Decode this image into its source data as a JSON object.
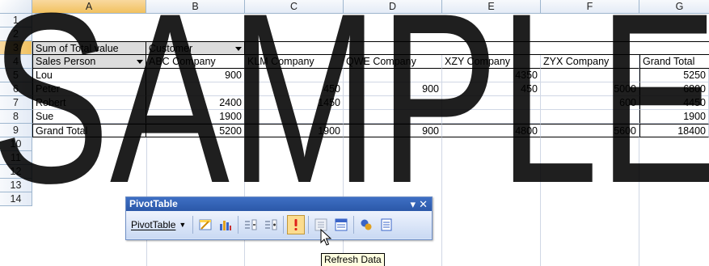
{
  "columns": [
    "A",
    "B",
    "C",
    "D",
    "E",
    "F",
    "G"
  ],
  "selected_column": "A",
  "row_numbers": [
    "1",
    "2",
    "3",
    "4",
    "5",
    "6",
    "7",
    "8",
    "9",
    "10",
    "11",
    "12",
    "13",
    "14"
  ],
  "selected_row": "3",
  "pivot": {
    "data_field": "Sum of Total value",
    "column_field": "Customer",
    "row_field": "Sales Person",
    "column_headers": [
      "ABC Company",
      "KLM Company",
      "QWE Company",
      "XZY Company",
      "ZYX Company",
      "Grand Total"
    ],
    "rows": [
      {
        "label": "Lou",
        "values": [
          "900",
          "",
          "",
          "4350",
          "",
          "5250"
        ]
      },
      {
        "label": "Peter",
        "values": [
          "",
          "450",
          "900",
          "450",
          "5000",
          "6800"
        ]
      },
      {
        "label": "Robert",
        "values": [
          "2400",
          "1450",
          "",
          "",
          "600",
          "4450"
        ]
      },
      {
        "label": "Sue",
        "values": [
          "1900",
          "",
          "",
          "",
          "",
          "1900"
        ]
      }
    ],
    "grand_total": {
      "label": "Grand Total",
      "values": [
        "5200",
        "1900",
        "900",
        "4800",
        "5600",
        "18400"
      ]
    }
  },
  "toolbar": {
    "title": "PivotTable",
    "menu_label": "PivotTable",
    "menu_chevron_icon": "dropdown-triangle",
    "title_dropdown_icon": "chevron-down",
    "title_close_icon": "close-x",
    "tools": [
      {
        "name": "format-report-icon"
      },
      {
        "name": "chart-wizard-icon"
      },
      {
        "name": "hide-detail-icon"
      },
      {
        "name": "show-detail-icon"
      },
      {
        "name": "refresh-data-icon"
      },
      {
        "name": "include-hidden-items-icon"
      },
      {
        "name": "always-display-items-icon"
      },
      {
        "name": "field-settings-icon"
      },
      {
        "name": "show-field-list-icon"
      }
    ],
    "pressed_tool": "refresh-data-icon"
  },
  "tooltip": "Refresh Data",
  "watermark_text": "SAMPLE",
  "colors": {
    "header_bg": "#e4ebf6",
    "selected_header": "#f1c15f",
    "toolbar_title": "#2b58a8",
    "refresh_icon": "#e0201b",
    "grid_line": "#d0d7e5",
    "watermark": "#000000"
  }
}
